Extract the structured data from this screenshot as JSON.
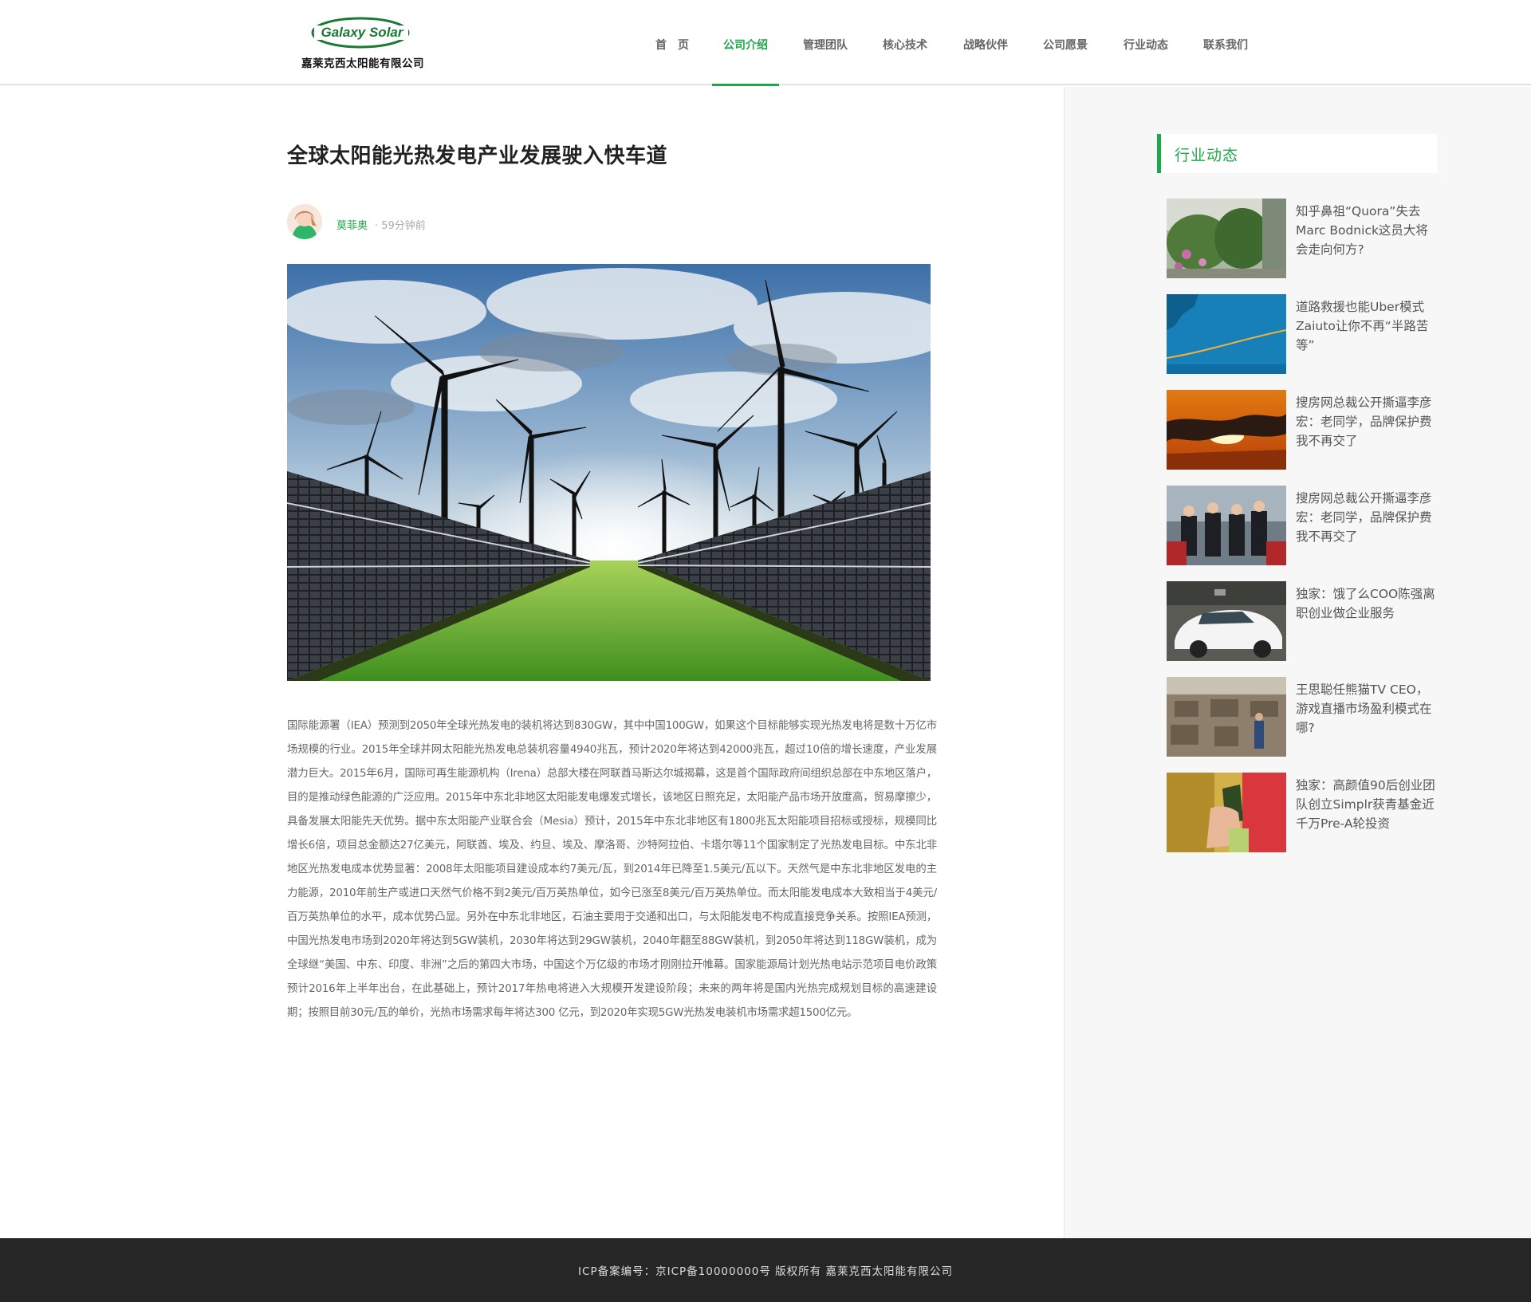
{
  "header": {
    "logo_text": "Galaxy Solar",
    "company_name": "嘉莱克西太阳能有限公司",
    "nav": [
      {
        "label": "首　页"
      },
      {
        "label": "公司介绍"
      },
      {
        "label": "管理团队"
      },
      {
        "label": "核心技术"
      },
      {
        "label": "战略伙伴"
      },
      {
        "label": "公司愿景"
      },
      {
        "label": "行业动态"
      },
      {
        "label": "联系我们"
      }
    ],
    "active_nav": "公司介绍"
  },
  "article": {
    "title": "全球太阳能光热发电产业发展驶入快车道",
    "author": "莫菲奥",
    "time": "· 59分钟前",
    "body": "国际能源署（IEA）预测到2050年全球光热发电的装机将达到830GW，其中中国100GW，如果这个目标能够实现光热发电将是数十万亿市场规模的行业。2015年全球并网太阳能光热发电总装机容量4940兆瓦，预计2020年将达到42000兆瓦，超过10倍的增长速度，产业发展潜力巨大。2015年6月，国际可再生能源机构（Irena）总部大楼在阿联酋马斯达尔城揭幕，这是首个国际政府间组织总部在中东地区落户，目的是推动绿色能源的广泛应用。2015年中东北非地区太阳能发电爆发式增长，该地区日照充足，太阳能产品市场开放度高，贸易摩擦少，具备发展太阳能先天优势。据中东太阳能产业联合会（Mesia）预计，2015年中东北非地区有1800兆瓦太阳能项目招标或授标，规模同比增长6倍，项目总金额达27亿美元，阿联酋、埃及、约旦、埃及、摩洛哥、沙特阿拉伯、卡塔尔等11个国家制定了光热发电目标。中东北非地区光热发电成本优势显著：2008年太阳能项目建设成本约7美元/瓦，到2014年已降至1.5美元/瓦以下。天然气是中东北非地区发电的主力能源，2010年前生产或进口天然气价格不到2美元/百万英热单位，如今已涨至8美元/百万英热单位。而太阳能发电成本大致相当于4美元/百万英热单位的水平，成本优势凸显。另外在中东北非地区，石油主要用于交通和出口，与太阳能发电不构成直接竞争关系。按照IEA预测，中国光热发电市场到2020年将达到5GW装机，2030年将达到29GW装机，2040年翻至88GW装机，到2050年将达到118GW装机，成为全球继“美国、中东、印度、非洲”之后的第四大市场，中国这个万亿级的市场才刚刚拉开帷幕。国家能源局计划光热电站示范项目电价政策预计2016年上半年出台，在此基础上，预计2017年热电将进入大规模开发建设阶段；未来的两年将是国内光热完成规划目标的高速建设期；按照目前30元/瓦的单价，光热市场需求每年将达300 亿元，到2020年实现5GW光热发电装机市场需求超1500亿元。"
  },
  "sidebar": {
    "heading": "行业动态",
    "items": [
      {
        "title": "知乎鼻祖“Quora”失去Marc Bodnick这员大将会走向何方?"
      },
      {
        "title": "道路救援也能Uber模式 Zaiuto让你不再“半路苦等”"
      },
      {
        "title": "搜房网总裁公开撕逼李彦宏：老同学，品牌保护费我不再交了"
      },
      {
        "title": "搜房网总裁公开撕逼李彦宏：老同学，品牌保护费我不再交了"
      },
      {
        "title": "独家：饿了么COO陈强离职创业做企业服务"
      },
      {
        "title": "王思聪任熊猫TV CEO，游戏直播市场盈利模式在哪?"
      },
      {
        "title": "独家：高颜值90后创业团队创立Simplr获青基金近千万Pre-A轮投资"
      }
    ]
  },
  "footer": {
    "text": "ICP备案编号：京ICP备10000000号  版权所有  嘉莱克西太阳能有限公司"
  },
  "colors": {
    "accent": "#1fa84b",
    "footer_bg": "#262626",
    "sidebar_bg": "#f7f7f7"
  }
}
